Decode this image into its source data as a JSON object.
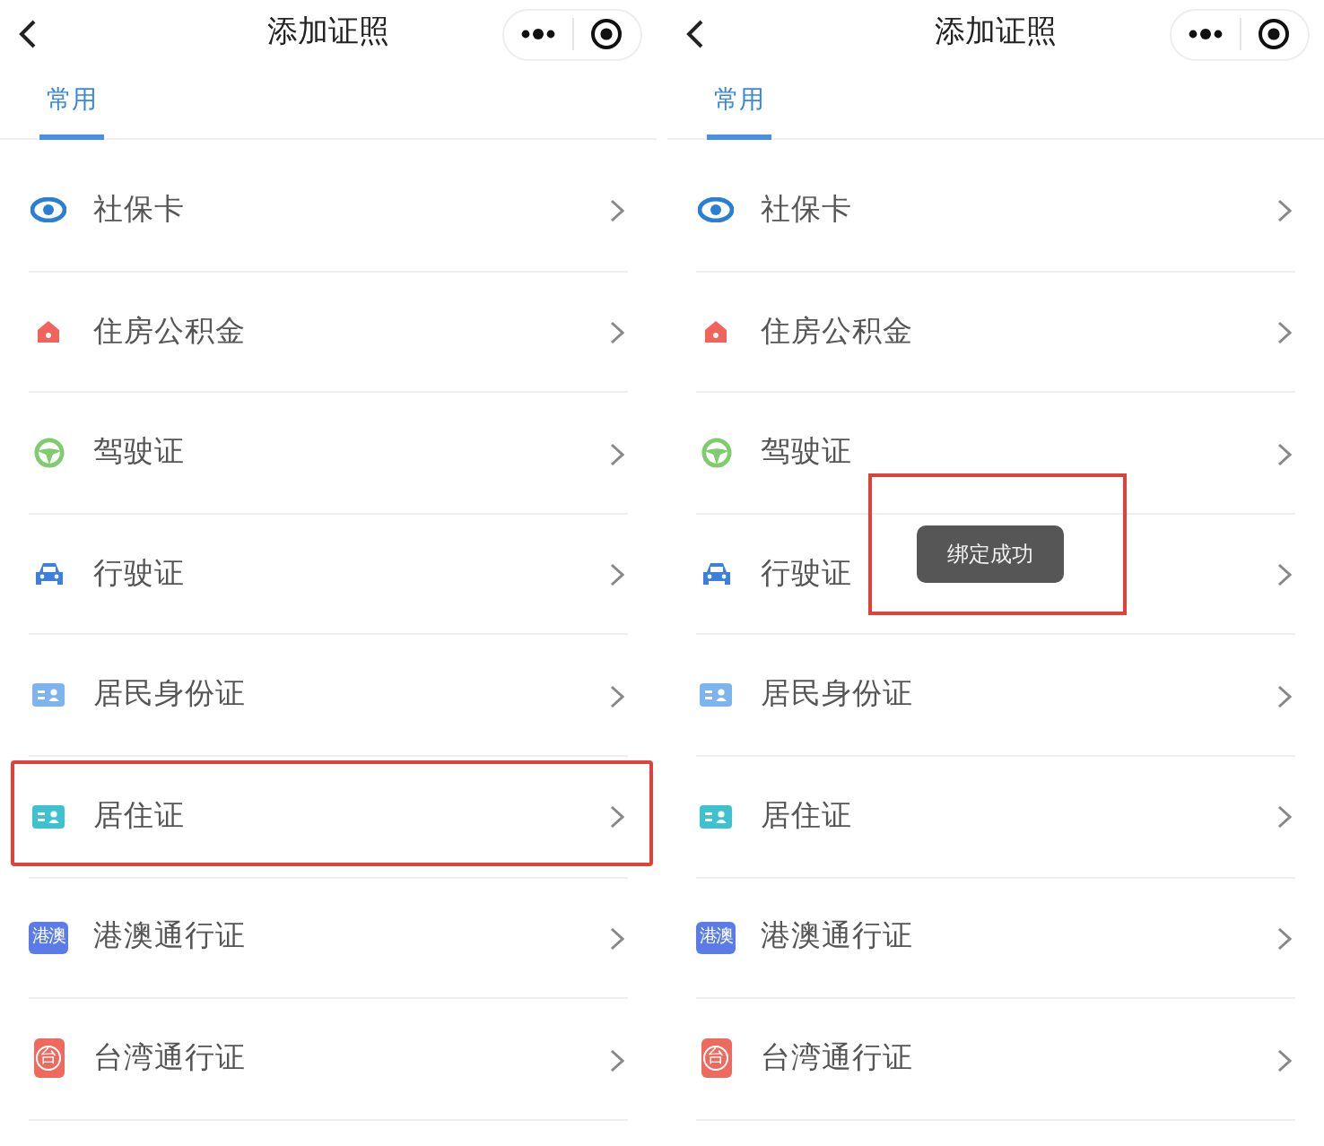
{
  "screens": [
    {
      "title": "添加证照",
      "tabs": [
        {
          "label": "常用",
          "selected": true
        }
      ],
      "items": [
        {
          "label": "社保卡",
          "kind": "social",
          "highlighted": false
        },
        {
          "label": "住房公积金",
          "kind": "home",
          "highlighted": false
        },
        {
          "label": "驾驶证",
          "kind": "wheel",
          "highlighted": false
        },
        {
          "label": "行驶证",
          "kind": "car",
          "highlighted": false
        },
        {
          "label": "居民身份证",
          "kind": "idcard",
          "highlighted": false
        },
        {
          "label": "居住证",
          "kind": "residence",
          "highlighted": true
        },
        {
          "label": "港澳通行证",
          "kind": "hk",
          "icon_text": "港澳",
          "highlighted": false
        },
        {
          "label": "台湾通行证",
          "kind": "tw",
          "icon_text": "台",
          "highlighted": false
        }
      ]
    },
    {
      "title": "添加证照",
      "tabs": [
        {
          "label": "常用",
          "selected": true
        }
      ],
      "items": [
        {
          "label": "社保卡",
          "kind": "social",
          "highlighted": false
        },
        {
          "label": "住房公积金",
          "kind": "home",
          "highlighted": false
        },
        {
          "label": "驾驶证",
          "kind": "wheel",
          "highlighted": false
        },
        {
          "label": "行驶证",
          "kind": "car",
          "highlighted": false
        },
        {
          "label": "居民身份证",
          "kind": "idcard",
          "highlighted": false
        },
        {
          "label": "居住证",
          "kind": "residence",
          "highlighted": false
        },
        {
          "label": "港澳通行证",
          "kind": "hk",
          "icon_text": "港澳",
          "highlighted": false
        },
        {
          "label": "台湾通行证",
          "kind": "tw",
          "icon_text": "台",
          "highlighted": false
        }
      ],
      "toast": {
        "text": "绑定成功",
        "highlighted": true
      }
    }
  ]
}
